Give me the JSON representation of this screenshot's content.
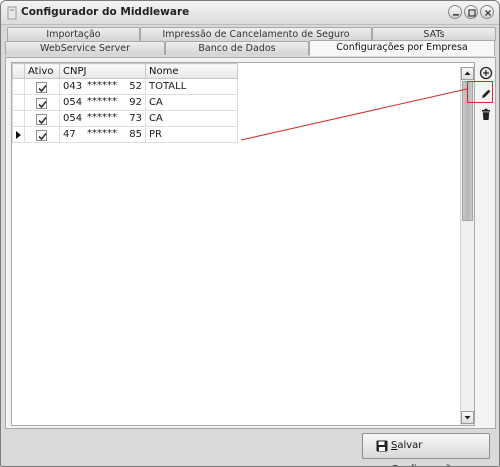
{
  "window": {
    "title": "Configurador do Middleware"
  },
  "tabs": {
    "row1": [
      {
        "label": "Importação"
      },
      {
        "label": "Impressão de Cancelamento de Seguro"
      },
      {
        "label": "SATs"
      }
    ],
    "row2": [
      {
        "label": "WebService Server"
      },
      {
        "label": "Banco de Dados"
      },
      {
        "label": "Configurações por Empresa",
        "active": true
      }
    ]
  },
  "grid": {
    "columns": [
      "Ativo",
      "CNPJ",
      "Nome"
    ],
    "rows": [
      {
        "ativo": true,
        "cnpj_prefix": "043",
        "cnpj_mask": "******",
        "cnpj_suffix": "52",
        "nome": "TOTALL"
      },
      {
        "ativo": true,
        "cnpj_prefix": "054",
        "cnpj_mask": "******",
        "cnpj_suffix": "92",
        "nome": "CA"
      },
      {
        "ativo": true,
        "cnpj_prefix": "054",
        "cnpj_mask": "******",
        "cnpj_suffix": "73",
        "nome": "CA"
      },
      {
        "ativo": true,
        "cnpj_prefix": "47",
        "cnpj_mask": "******",
        "cnpj_suffix": "85",
        "nome": "PR",
        "current": true
      }
    ]
  },
  "tools": {
    "add_icon": "plus-circle-icon",
    "edit_icon": "pencil-icon",
    "delete_icon": "trash-icon"
  },
  "footer": {
    "save_prefix": "",
    "save_underlined": "S",
    "save_rest": "alvar Configurações"
  },
  "colors": {
    "annotation": "#d22b2b",
    "window_bg": "#d9d9d9"
  }
}
